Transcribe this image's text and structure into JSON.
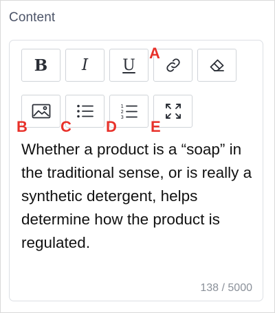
{
  "field": {
    "label": "Content"
  },
  "toolbar": {
    "bold_glyph": "B",
    "italic_glyph": "I",
    "underline_glyph": "U",
    "icons": [
      "bold-icon",
      "italic-icon",
      "underline-icon",
      "link-icon",
      "eraser-icon",
      "image-icon",
      "bulleted-list-icon",
      "numbered-list-icon",
      "fullscreen-icon"
    ]
  },
  "callouts": {
    "a": "A",
    "b": "B",
    "c": "C",
    "d": "D",
    "e": "E"
  },
  "editor": {
    "text": "Whether a product is a “soap” in the traditional sense, or is really a synthetic detergent, helps determine how the product is regulated.",
    "counter": "138 / 5000"
  },
  "colors": {
    "callout": "#e8312a",
    "label": "#4c5468",
    "border": "#cfd3d8",
    "counter": "#8a9099"
  }
}
